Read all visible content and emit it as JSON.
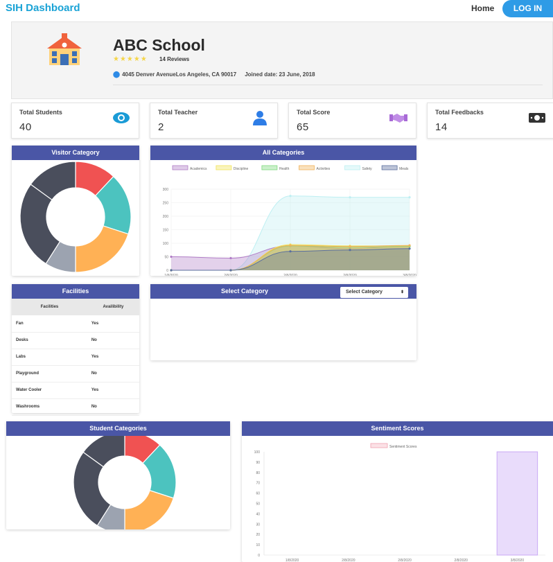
{
  "nav": {
    "brand": "SIH Dashboard",
    "home": "Home",
    "login": "LOG IN"
  },
  "school": {
    "name": "ABC School",
    "reviews": "14 Reviews",
    "address": "4045 Denver AvenueLos Angeles, CA 90017",
    "joined": "Joined date: 23 June, 2018",
    "star_count": 5
  },
  "stats": [
    {
      "title": "Total Students",
      "value": "40",
      "icon": "eye-icon",
      "color": "#1a9bd6"
    },
    {
      "title": "Total Teacher",
      "value": "2",
      "icon": "user-icon",
      "color": "#2e7de6"
    },
    {
      "title": "Total Score",
      "value": "65",
      "icon": "handshake-icon",
      "color": "#a86ad6"
    },
    {
      "title": "Total Feedbacks",
      "value": "14",
      "icon": "money-icon",
      "color": "#333333"
    }
  ],
  "cards": {
    "visitor": "Visitor Category",
    "all": "All Categories",
    "facilities": "Facilities",
    "select": "Select Category",
    "select_button": "Select Category",
    "students": "Student Categories",
    "sentiment": "Sentiment Scores"
  },
  "facilities": {
    "headers": [
      "Facilities",
      "Availibility"
    ],
    "rows": [
      [
        "Fan",
        "Yes"
      ],
      [
        "Desks",
        "No"
      ],
      [
        "Labs",
        "Yes"
      ],
      [
        "Playground",
        "No"
      ],
      [
        "Water Cooler",
        "Yes"
      ],
      [
        "Washrooms",
        "No"
      ]
    ]
  },
  "chart_data": [
    {
      "type": "pie",
      "title": "Visitor Category",
      "values": [
        12,
        18,
        20,
        9,
        26,
        15
      ],
      "colors": [
        "#f05252",
        "#4cc3bf",
        "#ffb155",
        "#9ca3b0",
        "#4a4e5c",
        "#4a4e5c"
      ]
    },
    {
      "type": "area",
      "title": "All Categories",
      "x": [
        "1/8/2020",
        "2/8/2020",
        "2/8/2020",
        "2/8/2020",
        "3/8/2020"
      ],
      "ylim": [
        0,
        300
      ],
      "yticks": [
        0,
        50,
        100,
        150,
        200,
        250,
        300
      ],
      "series": [
        {
          "name": "Academics",
          "values": [
            50,
            45,
            90,
            80,
            90
          ],
          "color": "#b07cc6"
        },
        {
          "name": "Discipline",
          "values": [
            0,
            0,
            95,
            90,
            90
          ],
          "color": "#f0e35a"
        },
        {
          "name": "Health",
          "values": [
            0,
            0,
            90,
            85,
            88
          ],
          "color": "#7ed97e"
        },
        {
          "name": "Activities",
          "values": [
            0,
            0,
            92,
            88,
            92
          ],
          "color": "#f0b35a"
        },
        {
          "name": "Safety",
          "values": [
            0,
            0,
            275,
            270,
            270
          ],
          "color": "#bdeff2"
        },
        {
          "name": "Meals",
          "values": [
            0,
            0,
            70,
            75,
            80
          ],
          "color": "#5a6f9e"
        }
      ]
    },
    {
      "type": "pie",
      "title": "Student Categories",
      "values": [
        12,
        18,
        20,
        9,
        26,
        15
      ],
      "colors": [
        "#f05252",
        "#4cc3bf",
        "#ffb155",
        "#9ca3b0",
        "#4a4e5c",
        "#4a4e5c"
      ]
    },
    {
      "type": "bar",
      "title": "Sentiment Scores",
      "categories": [
        "1/8/2020",
        "2/8/2020",
        "2/8/2020",
        "2/8/2020",
        "3/8/2020"
      ],
      "series": [
        {
          "name": "Sentiment Scores",
          "values": [
            0,
            0,
            0,
            0,
            100
          ]
        }
      ],
      "ylim": [
        0,
        100
      ],
      "yticks": [
        0,
        10,
        20,
        30,
        40,
        50,
        60,
        70,
        80,
        90,
        100
      ],
      "bar_color": "#e9dcfb",
      "bar_border": "#c9a9f5"
    }
  ]
}
